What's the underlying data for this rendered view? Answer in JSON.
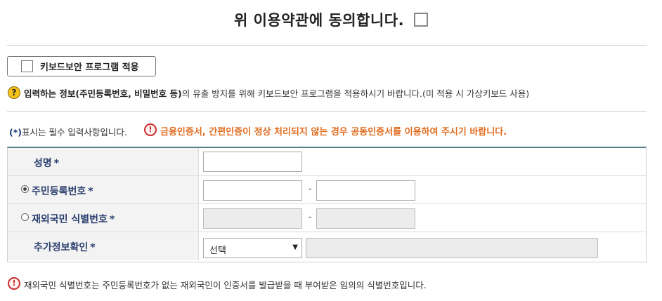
{
  "agreement": {
    "text": "위 이용약관에 동의합니다.",
    "checked": false
  },
  "keyboard_security": {
    "label": "키보드보안 프로그램 적용",
    "checked": false
  },
  "notes": {
    "security_bold": "입력하는 정보(주민등록번호, 비밀번호 등)",
    "security_rest": "의 유출 방지를 위해 키보드보안 프로그램을 적용하시기 바랍니다.(미 적용 시 가상키보드 사용)",
    "required_star": "(*)",
    "required_text": "표시는 필수 입력사항입니다.",
    "cert_warning": "금융인증서, 간편인증이 정상 처리되지 않는 경우 공동인증서를 이용하여 주시기 바랍니다.",
    "footnote": "재외국민 식별번호는 주민등록번호가 없는 재외국민이 인증서를 발급받을 때 부여받은 임의의 식별번호입니다."
  },
  "form": {
    "name": {
      "label": "성명",
      "star": "*",
      "value": ""
    },
    "resident_number": {
      "label": "주민등록번호",
      "star": "*",
      "selected": true,
      "part1": "",
      "part2": "",
      "separator": "-"
    },
    "foreign_number": {
      "label": "재외국민 식별번호",
      "star": "*",
      "selected": false,
      "part1": "",
      "part2": "",
      "separator": "-",
      "disabled": true
    },
    "extra_check": {
      "label": "추가정보확인",
      "star": "*",
      "select_value": "선택",
      "detail": ""
    }
  },
  "icons": {
    "help": "question-circle-icon",
    "warning": "exclamation-circle-icon",
    "dropdown": "caret-down-icon"
  }
}
